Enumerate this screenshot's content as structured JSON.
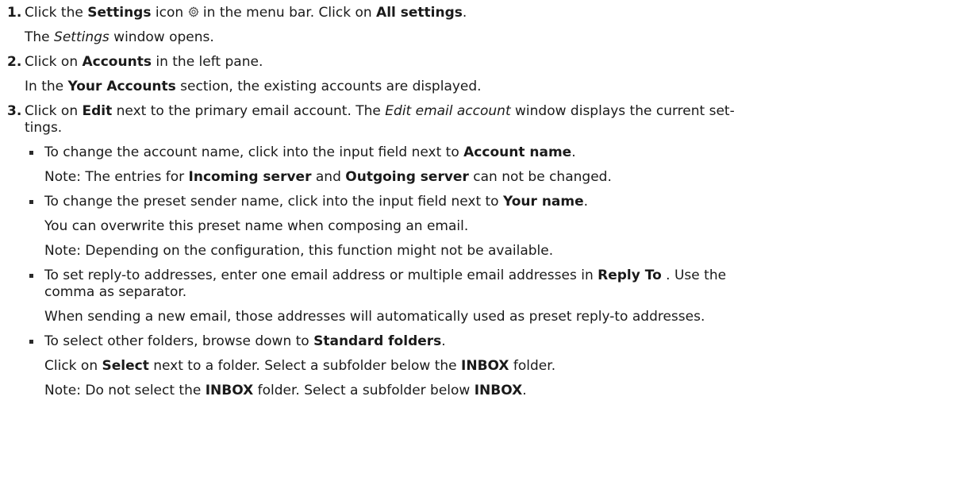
{
  "steps": [
    {
      "num": "1.",
      "lines": [
        {
          "p1": "Click the ",
          "b1": "Settings",
          "p2": " icon ",
          "p3": " in the menu bar. Click on ",
          "b2": "All settings",
          "p4": "."
        },
        {
          "p1": "The ",
          "i1": "Settings",
          "p2": " window opens."
        }
      ],
      "icon": "gear-icon"
    },
    {
      "num": "2.",
      "lines": [
        {
          "p1": "Click on ",
          "b1": "Accounts",
          "p2": " in the left pane."
        },
        {
          "p1": "In the ",
          "b1": "Your Accounts",
          "p2": " section, the existing accounts are displayed."
        }
      ]
    },
    {
      "num": "3.",
      "lines": [
        {
          "p1": "Click on ",
          "b1": "Edit",
          "p2": " next to the primary email account. The ",
          "i1": "Edit email account",
          "p3": " window displays the current set-",
          "p4": "tings."
        }
      ],
      "bullets": [
        {
          "lines": [
            {
              "p1": "To change the account name, click into the input field next to ",
              "b1": "Account name",
              "p2": "."
            },
            {
              "p1": "Note: The entries for ",
              "b1": "Incoming server",
              "p2": " and ",
              "b2": "Outgoing server",
              "p3": " can not be changed."
            }
          ]
        },
        {
          "lines": [
            {
              "p1": "To change the preset sender name, click into the input field next to ",
              "b1": "Your name",
              "p2": "."
            },
            {
              "p1": "You can overwrite this preset name when composing an email."
            },
            {
              "p1": "Note: Depending on the configuration, this function might not be available."
            }
          ]
        },
        {
          "lines": [
            {
              "p1": "To set reply-to addresses, enter one email address or multiple email addresses in ",
              "b1": "Reply To",
              "p2": " . Use the",
              "p3": "comma as separator."
            },
            {
              "p1": "When sending a new email, those addresses will automatically used as preset reply-to addresses."
            }
          ]
        },
        {
          "lines": [
            {
              "p1": "To select other folders, browse down to ",
              "b1": "Standard folders",
              "p2": "."
            },
            {
              "p1": "Click on ",
              "b1": "Select",
              "p2": " next to a folder. Select a subfolder below the ",
              "b2": "INBOX",
              "p3": " folder."
            },
            {
              "p1": "Note: Do not select the ",
              "b1": "INBOX",
              "p2": " folder. Select a subfolder below ",
              "b2": "INBOX",
              "p3": "."
            }
          ]
        }
      ]
    }
  ]
}
